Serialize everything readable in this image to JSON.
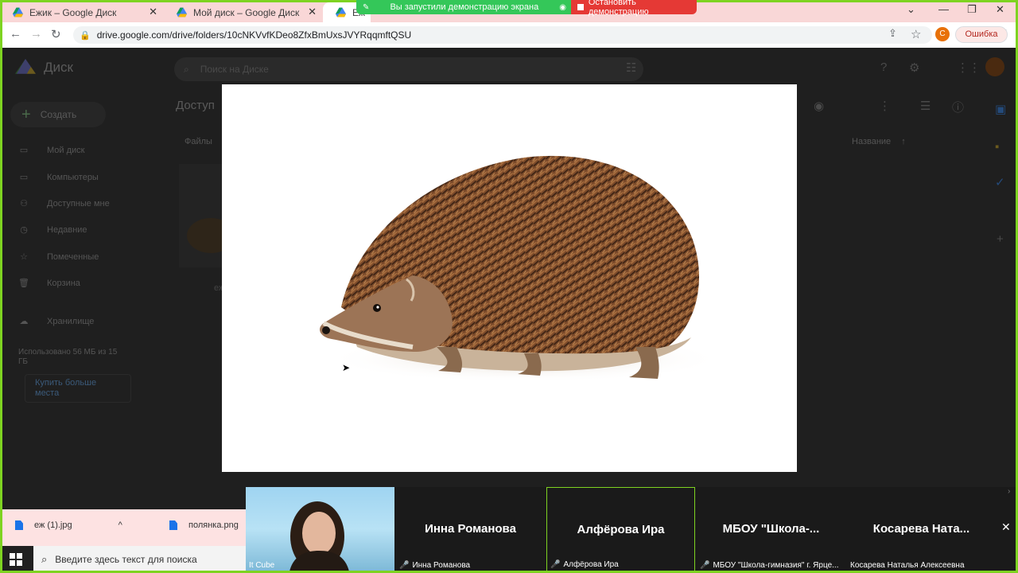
{
  "tabs": [
    {
      "title": "Ежик – Google Диск",
      "close": "✕"
    },
    {
      "title": "Мой диск – Google Диск",
      "close": "✕"
    },
    {
      "title": "Еж",
      "close": ""
    }
  ],
  "share_banner": {
    "message": "Вы запустили демонстрацию экрана",
    "stop_label": "Остановить демонстрацию"
  },
  "address": {
    "url": "drive.google.com/drive/folders/10cNKVvfKDeo8ZfxBmUxsJVYRqqmftQSU",
    "profile_initial": "С",
    "error_label": "Ошибка"
  },
  "drive": {
    "app_name": "Диск",
    "search_placeholder": "Поиск на Диске",
    "create_label": "Создать",
    "nav": [
      {
        "label": "Мой диск",
        "icon": "drive-icon"
      },
      {
        "label": "Компьютеры",
        "icon": "computer-icon"
      },
      {
        "label": "Доступные мне",
        "icon": "people-icon"
      },
      {
        "label": "Недавние",
        "icon": "clock-icon"
      },
      {
        "label": "Помеченные",
        "icon": "star-icon"
      },
      {
        "label": "Корзина",
        "icon": "trash-icon"
      },
      {
        "label": "Хранилище",
        "icon": "cloud-icon"
      }
    ],
    "storage_text": "Использовано 56 МБ из 15 ГБ",
    "buy_label": "Купить больше места",
    "heading": "Доступ",
    "files_label": "Файлы",
    "sort_label": "Название",
    "file_thumb_label": "еж"
  },
  "downloads": [
    {
      "name": "еж (1).jpg"
    },
    {
      "name": "полянка.png"
    }
  ],
  "participants": [
    {
      "name_big": "",
      "name_small": "It Cube",
      "muted": false,
      "video": true
    },
    {
      "name_big": "Инна Романова",
      "name_small": "Инна Романова",
      "muted": true
    },
    {
      "name_big": "Алфёрова Ира",
      "name_small": "Алфёрова Ира",
      "muted": true,
      "active": true
    },
    {
      "name_big": "МБОУ  \"Школа-...",
      "name_small": "МБОУ \"Школа-гимназия\" г. Ярце...",
      "muted": true
    },
    {
      "name_big": "Косарева  Ната...",
      "name_small": "Косарева Наталья Алексеевна",
      "muted": false
    }
  ],
  "taskbar": {
    "search_placeholder": "Введите здесь текст для поиска"
  },
  "colors": {
    "share_green": "#34c759",
    "share_red": "#e53935",
    "highlight_border": "#7ed321",
    "tabbar_bg": "#f9d7d7"
  }
}
